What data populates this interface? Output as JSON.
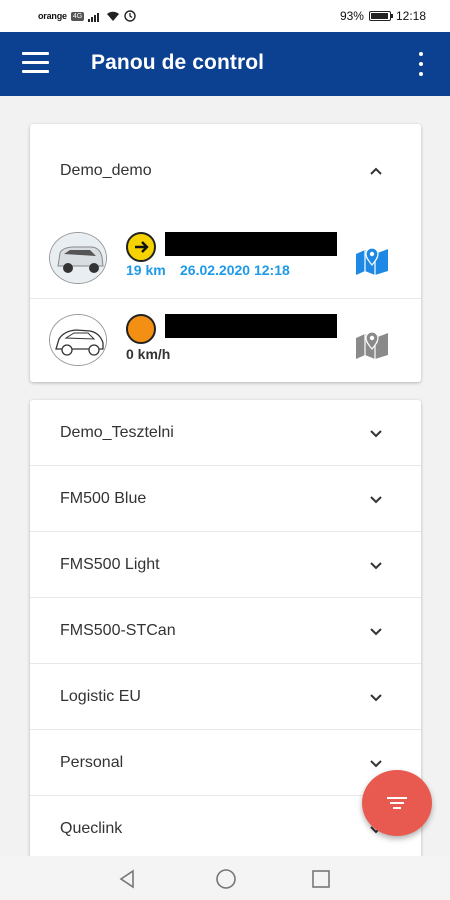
{
  "status_bar": {
    "carrier": "orange",
    "network": "4G",
    "battery": "93%",
    "time": "12:18"
  },
  "app_bar": {
    "title": "Panou de control"
  },
  "expanded_group": {
    "name": "Demo_demo",
    "vehicles": [
      {
        "speed": "19 km",
        "datetime": "26.02.2020 12:18",
        "status_color": "#f5d200",
        "map_color": "#1e88e5"
      },
      {
        "speed": "0 km/h",
        "datetime": "",
        "status_color": "#f39014",
        "map_color": "#8a8a8a"
      }
    ]
  },
  "groups": [
    {
      "name": "Demo_Tesztelni"
    },
    {
      "name": "FM500 Blue"
    },
    {
      "name": "FMS500 Light"
    },
    {
      "name": "FMS500-STCan"
    },
    {
      "name": "Logistic EU"
    },
    {
      "name": "Personal"
    },
    {
      "name": "Queclink"
    }
  ],
  "colors": {
    "app_bar": "#0c4191",
    "accent_blue": "#1e9ae8",
    "fab": "#e85a4f"
  }
}
